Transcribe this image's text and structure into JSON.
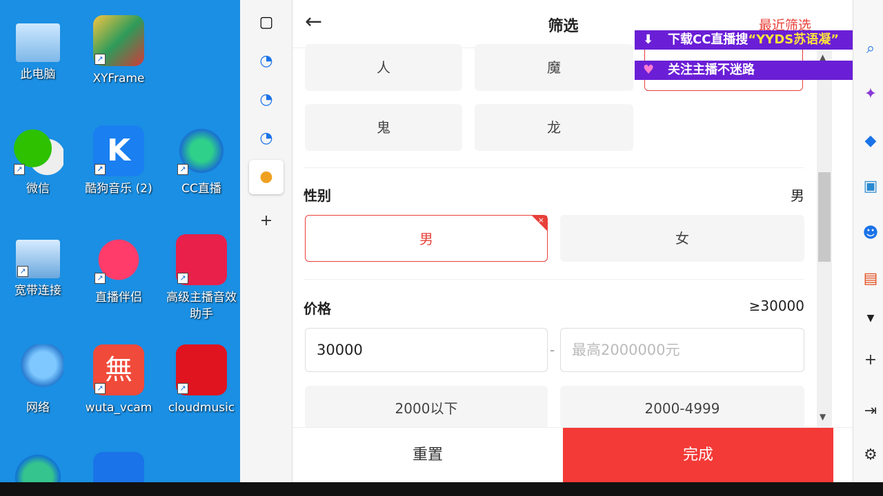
{
  "desktop": {
    "icons": [
      {
        "label": "此电脑"
      },
      {
        "label": "XYFrame"
      },
      {
        "label": "微信"
      },
      {
        "label": "酷狗音乐 (2)"
      },
      {
        "label": "CC直播"
      },
      {
        "label": "宽带连接"
      },
      {
        "label": "直播伴侣"
      },
      {
        "label": "高级主播音效助手"
      },
      {
        "label": "网络"
      },
      {
        "label": "wuta_vcam"
      },
      {
        "label": "cloudmusic"
      }
    ]
  },
  "header": {
    "title": "筛选",
    "recent": "最近筛选"
  },
  "race_options": [
    "人",
    "魔",
    "鬼",
    "龙"
  ],
  "gender": {
    "title": "性别",
    "value": "男",
    "options": [
      "男",
      "女"
    ]
  },
  "price": {
    "title": "价格",
    "value": "≥30000",
    "min_value": "30000",
    "max_placeholder": "最高2000000元",
    "dash": "-",
    "ranges": [
      "2000以下",
      "2000-4999"
    ]
  },
  "footer": {
    "reset": "重置",
    "done": "完成"
  },
  "overlay": {
    "banner1_prefix": "下载CC直播搜",
    "banner1_highlight": "“YYDS苏语凝”",
    "banner2": "关注主播不迷路"
  },
  "colors": {
    "accent": "#f33a36",
    "overlay": "#6a1fd6"
  }
}
